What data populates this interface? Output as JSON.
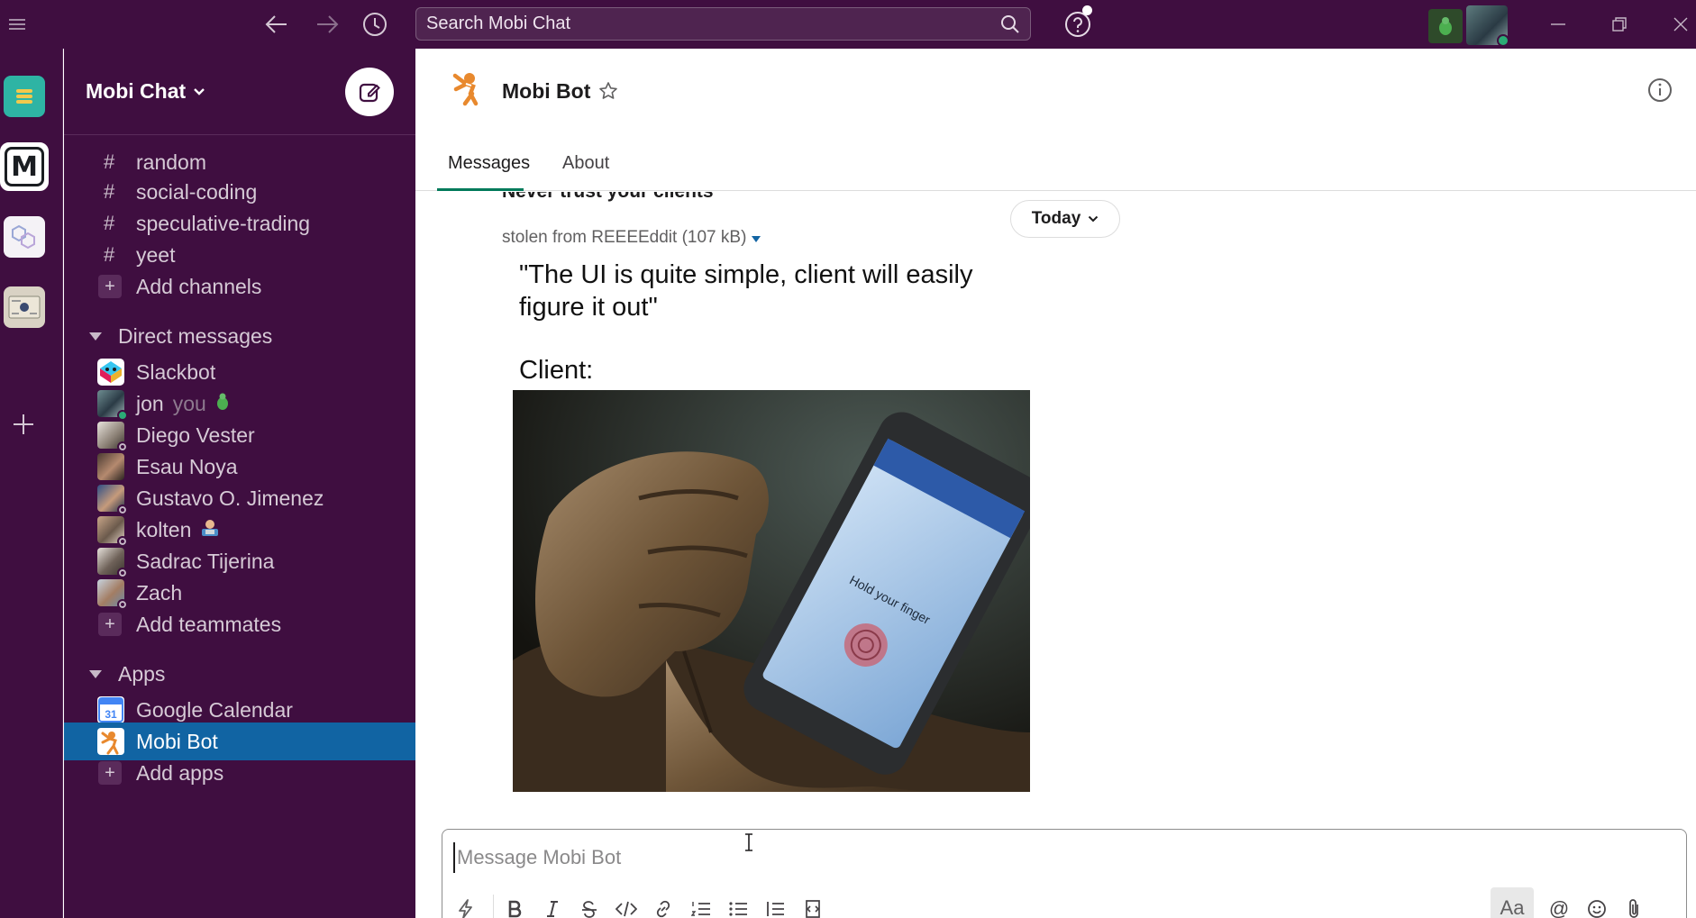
{
  "titlebar": {
    "search_placeholder": "Search Mobi Chat",
    "icons": [
      "menu-icon",
      "back-arrow-icon",
      "forward-arrow-icon",
      "history-icon",
      "search-icon",
      "help-icon",
      "minimize-icon",
      "restore-icon",
      "close-icon"
    ]
  },
  "workspace": {
    "name": "Mobi Chat",
    "rail_badge": "M"
  },
  "sidebar": {
    "channels": [
      "random",
      "social-coding",
      "speculative-trading",
      "yeet"
    ],
    "add_channels": "Add channels",
    "dm_header": "Direct messages",
    "dms": [
      {
        "name": "Slackbot",
        "you": ""
      },
      {
        "name": "jon",
        "you": "you"
      },
      {
        "name": "Diego Vester",
        "you": ""
      },
      {
        "name": "Esau Noya",
        "you": ""
      },
      {
        "name": "Gustavo O. Jimenez",
        "you": ""
      },
      {
        "name": "kolten",
        "you": ""
      },
      {
        "name": "Sadrac Tijerina",
        "you": ""
      },
      {
        "name": "Zach",
        "you": ""
      }
    ],
    "add_teammates": "Add teammates",
    "apps_header": "Apps",
    "apps": [
      "Google Calendar",
      "Mobi Bot"
    ],
    "add_apps": "Add apps",
    "calendar_day": "31",
    "add_symbol": "+",
    "hash_symbol": "#"
  },
  "channel": {
    "name": "Mobi Bot",
    "tabs": [
      "Messages",
      "About"
    ],
    "active_tab": "Messages"
  },
  "messages": {
    "cut_text": "Never trust your clients",
    "date_divider": "Today",
    "file_name": "stolen from REEEEddit (107 kB)",
    "meme_caption": "\"The UI is quite simple, client will easily\nfigure it out\"",
    "meme_client": "Client:",
    "phone_prompt": "Hold your finger"
  },
  "composer": {
    "placeholder": "Message Mobi Bot",
    "aa_label": "Aa",
    "at_label": "@"
  },
  "colors": {
    "aubergine": "#3f0e40",
    "active_item": "#1164a3",
    "online": "#2bac76",
    "tab_underline": "#007a5a"
  }
}
